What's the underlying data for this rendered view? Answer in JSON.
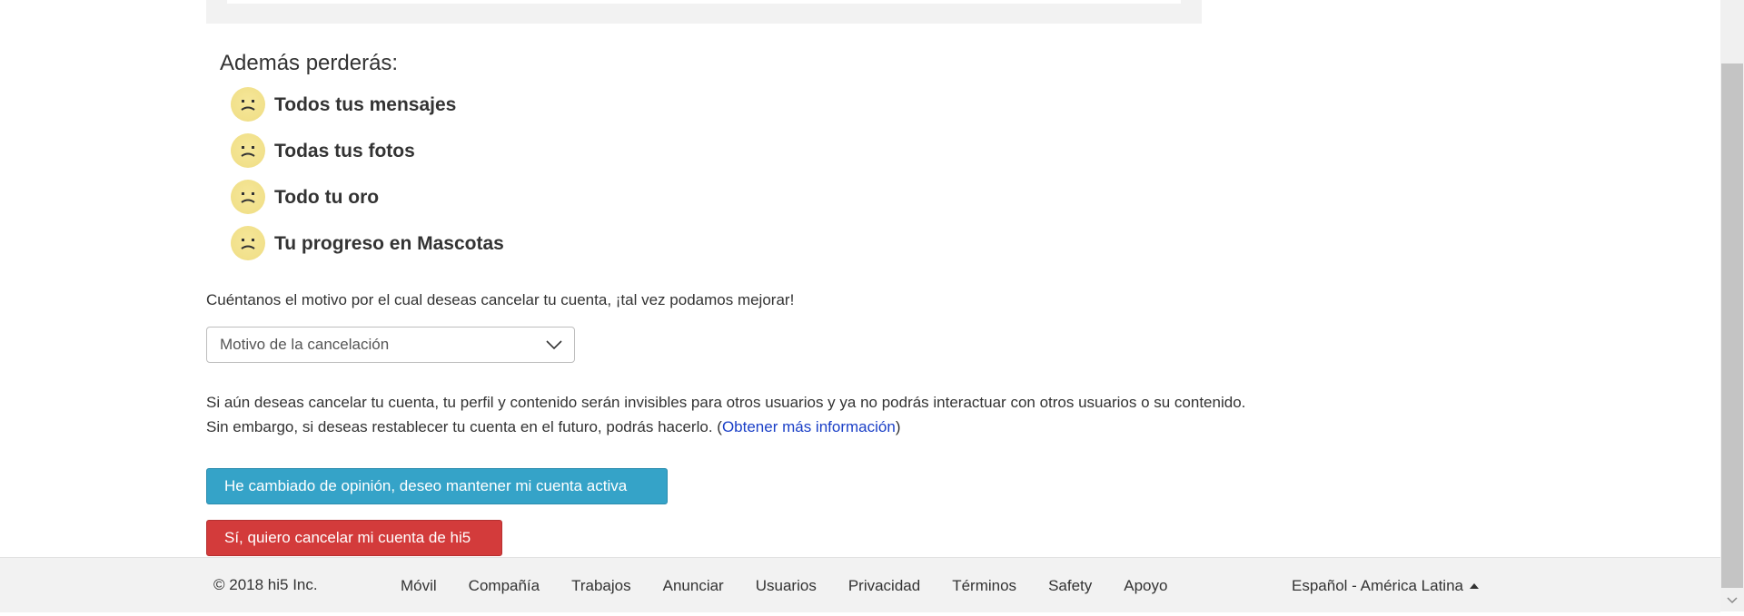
{
  "losses": {
    "title": "Además perderás:",
    "items": [
      {
        "label": "Todos tus mensajes"
      },
      {
        "label": "Todas tus fotos"
      },
      {
        "label": "Todo tu oro"
      },
      {
        "label": "Tu progreso en Mascotas"
      }
    ]
  },
  "reason": {
    "prompt": "Cuéntanos el motivo por el cual deseas cancelar tu cuenta, ¡tal vez podamos mejorar!",
    "select_value": "Motivo de la cancelación"
  },
  "info": {
    "line1": "Si aún deseas cancelar tu cuenta, tu perfil y contenido serán invisibles para otros usuarios y ya no podrás interactuar con otros usuarios o su contenido.",
    "line2_prefix": "Sin embargo, si deseas restablecer tu cuenta en el futuro, podrás hacerlo. (",
    "link": "Obtener más información",
    "line2_suffix": ")"
  },
  "buttons": {
    "keep": "He cambiado de opinión, deseo mantener mi cuenta activa",
    "cancel": "Sí, quiero cancelar mi cuenta de hi5"
  },
  "footer": {
    "copyright": "© 2018 hi5 Inc.",
    "links": [
      "Móvil",
      "Compañía",
      "Trabajos",
      "Anunciar",
      "Usuarios",
      "Privacidad",
      "Términos",
      "Safety",
      "Apoyo"
    ],
    "language": "Español - América Latina"
  },
  "colors": {
    "keep_button": "#35a3c8",
    "cancel_button": "#d33b3b",
    "link": "#1a3fc7",
    "sad_face": "#f1e08a"
  },
  "icons": {
    "loss_item": "sad-face-icon",
    "select": "chevron-down-icon",
    "language": "caret-up-icon"
  }
}
